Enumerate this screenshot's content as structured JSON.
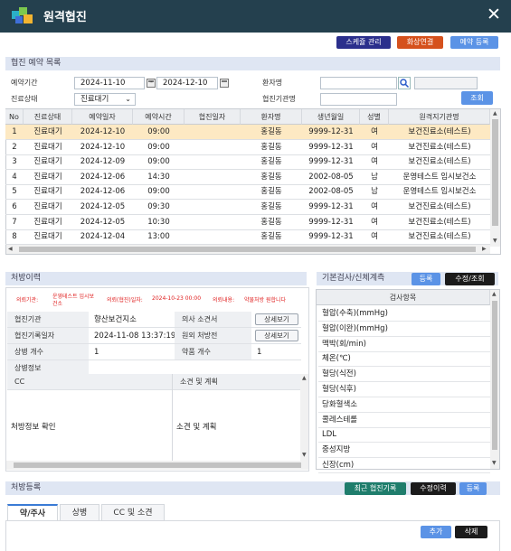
{
  "window": {
    "title": "원격협진"
  },
  "toolbar": {
    "schedule_btn": "스케쥴 관리",
    "video_btn": "화상연결",
    "booking_btn": "예약 등록"
  },
  "reservation": {
    "section_title": "협진 예약 목록",
    "period_label": "예약기간",
    "date_from": "2024-11-10",
    "date_to": "2024-12-10",
    "tilde": "-",
    "status_label": "진료상태",
    "status_value": "진료대기",
    "patient_label": "환자명",
    "org_label": "협진기관명",
    "search_btn": "조회",
    "columns": [
      "No",
      "진료상태",
      "예약일자",
      "예약시간",
      "협진일자",
      "환자명",
      "생년월일",
      "성별",
      "원격지기관명"
    ],
    "rows": [
      [
        "1",
        "진료대기",
        "2024-12-10",
        "09:00",
        "",
        "홍길동",
        "9999-12-31",
        "여",
        "보건진료소(테스트)"
      ],
      [
        "2",
        "진료대기",
        "2024-12-10",
        "09:00",
        "",
        "홍길동",
        "9999-12-31",
        "여",
        "보건진료소(테스트)"
      ],
      [
        "3",
        "진료대기",
        "2024-12-09",
        "09:00",
        "",
        "홍길동",
        "9999-12-31",
        "여",
        "보건진료소(테스트)"
      ],
      [
        "4",
        "진료대기",
        "2024-12-06",
        "14:30",
        "",
        "홍길동",
        "2002-08-05",
        "남",
        "운영테스트 임시보건소"
      ],
      [
        "5",
        "진료대기",
        "2024-12-06",
        "09:00",
        "",
        "홍길동",
        "2002-08-05",
        "남",
        "운영테스트 임시보건소"
      ],
      [
        "6",
        "진료대기",
        "2024-12-05",
        "09:30",
        "",
        "홍길동",
        "9999-12-31",
        "여",
        "보건진료소(테스트)"
      ],
      [
        "7",
        "진료대기",
        "2024-12-05",
        "10:30",
        "",
        "홍길동",
        "9999-12-31",
        "여",
        "보건진료소(테스트)"
      ],
      [
        "8",
        "진료대기",
        "2024-12-04",
        "13:00",
        "",
        "홍길동",
        "9999-12-31",
        "여",
        "보건진료소(테스트)"
      ]
    ]
  },
  "prescription_history": {
    "section_title": "처방이력",
    "red_org_label": "의뢰기관:",
    "red_org_value": "운영테스트 임시보건소",
    "red_date_label": "의뢰(협진)일자:",
    "red_date_value": "2024-10-23 00:00",
    "red_content_label": "의뢰내용:",
    "red_content_value": "약물처방 원합니다",
    "org_label": "협진기관",
    "org_value": "향산보건지소",
    "doctor_label": "의사 소견서",
    "doctor_btn": "상세보기",
    "datetime_label": "협진기록일자",
    "datetime_value": "2024-11-08 13:37:19",
    "remote_label": "원외 처방전",
    "remote_btn": "상세보기",
    "disease_count_label": "상병 개수",
    "disease_count_value": "1",
    "drug_count_label": "약품 개수",
    "drug_count_value": "1",
    "disease_info_label": "상병정보",
    "cc_label": "CC",
    "plan_label": "소견 및 계획",
    "cc_value": "처방정보 확인",
    "plan_value": "소견 및 계획"
  },
  "measurements": {
    "section_title": "기본검사/신체계측",
    "register_btn": "등록",
    "edit_btn": "수정/조회",
    "header": "검사항목",
    "items": [
      "혈압(수축)(mmHg)",
      "혈압(이완)(mmHg)",
      "맥박(회/min)",
      "체온(℃)",
      "혈당(식전)",
      "혈당(식후)",
      "당화혈색소",
      "콜레스테롤",
      "LDL",
      "중성지방",
      "신장(cm)"
    ]
  },
  "prescription_register": {
    "section_title": "처방등록",
    "recent_btn": "최근 협진기록",
    "edit_history_btn": "수정이력",
    "register_btn": "등록",
    "tabs": [
      "약/주사",
      "상병",
      "CC 및 소견"
    ],
    "add_btn": "추가",
    "delete_btn": "삭제"
  },
  "colors": {
    "titlebar": "#24404e",
    "navy_btn": "#2b2f8c",
    "orange_btn": "#d5511d",
    "blue_btn": "#5b93e6",
    "selected_row": "#fde9c3",
    "teal_btn": "#1f7d6c",
    "black_btn": "#1b1b1b",
    "red_text": "#e02020"
  }
}
